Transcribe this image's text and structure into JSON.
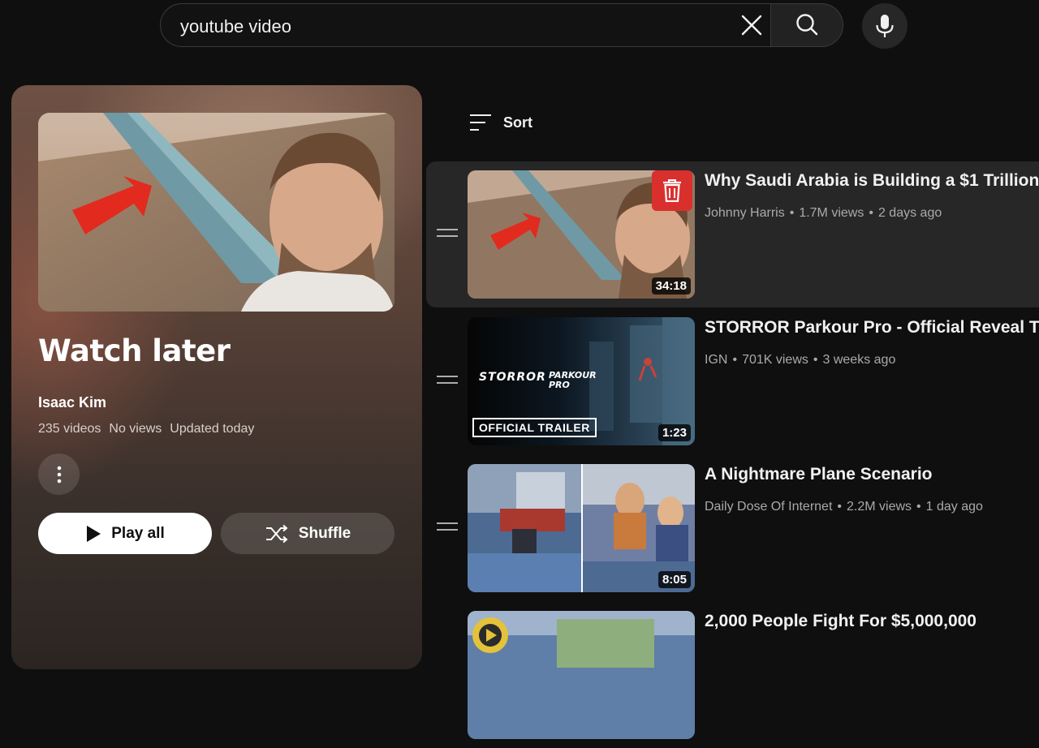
{
  "search": {
    "query": "youtube video"
  },
  "playlist": {
    "title": "Watch later",
    "owner": "Isaac Kim",
    "video_count": "235 videos",
    "views": "No views",
    "updated": "Updated today",
    "play_all_label": "Play all",
    "shuffle_label": "Shuffle"
  },
  "sort": {
    "label": "Sort"
  },
  "videos": [
    {
      "title": "Why Saudi Arabia is Building a $1 Trillion",
      "channel": "Johnny Harris",
      "views": "1.7M views",
      "age": "2 days ago",
      "duration": "34:18"
    },
    {
      "title": "STORROR Parkour Pro - Official Reveal Tr",
      "channel": "IGN",
      "views": "701K views",
      "age": "3 weeks ago",
      "duration": "1:23",
      "thumb_logo": "STORROR",
      "thumb_sub": "PARKOUR PRO",
      "thumb_badge": "OFFICIAL TRAILER"
    },
    {
      "title": "A Nightmare Plane Scenario",
      "channel": "Daily Dose Of Internet",
      "views": "2.2M views",
      "age": "1 day ago",
      "duration": "8:05"
    },
    {
      "title": "2,000 People Fight For $5,000,000"
    }
  ],
  "colors": {
    "background": "#0f0f0f",
    "row_selected": "#272727",
    "delete_red": "#d9302e"
  }
}
